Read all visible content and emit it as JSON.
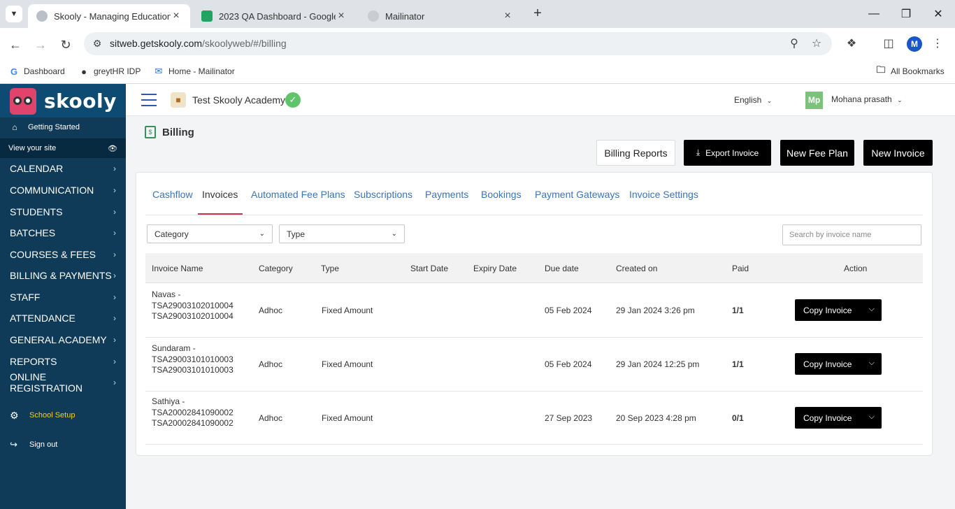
{
  "browser": {
    "tabs": [
      {
        "title": "Skooly - Managing Educational",
        "active": true
      },
      {
        "title": "2023 QA Dashboard - Google S",
        "active": false
      },
      {
        "title": "Mailinator",
        "active": false
      }
    ],
    "url_host": "sitweb.getskooly.com",
    "url_path": "/skoolyweb/#/billing",
    "profile_initial": "M",
    "bookmarks": [
      "Dashboard",
      "greytHR IDP",
      "Home - Mailinator"
    ],
    "all_bookmarks": "All Bookmarks"
  },
  "sidebar": {
    "brand": "skooly",
    "getting_started": "Getting Started",
    "view_site": "View your site",
    "menu": [
      "CALENDAR",
      "COMMUNICATION",
      "STUDENTS",
      "BATCHES",
      "COURSES & FEES",
      "BILLING & PAYMENTS",
      "STAFF",
      "ATTENDANCE",
      "GENERAL ACADEMY",
      "REPORTS",
      "ONLINE REGISTRATION"
    ],
    "school_setup": "School Setup",
    "sign_out": "Sign out"
  },
  "header": {
    "school_name": "Test Skooly Academy",
    "language": "English",
    "user_initials": "Mp",
    "user_name": "Mohana prasath"
  },
  "page": {
    "title": "Billing",
    "buttons": {
      "billing_reports": "Billing Reports",
      "export_invoice": "Export Invoice",
      "new_fee_plan": "New Fee Plan",
      "new_invoice": "New Invoice"
    },
    "tabs": [
      "Cashflow",
      "Invoices",
      "Automated Fee Plans",
      "Subscriptions",
      "Payments",
      "Bookings",
      "Payment Gateways",
      "Invoice Settings"
    ],
    "active_tab": "Invoices",
    "filters": {
      "category": "Category",
      "type": "Type",
      "search_placeholder": "Search by invoice name"
    },
    "table": {
      "columns": [
        "Invoice Name",
        "Category",
        "Type",
        "Start Date",
        "Expiry Date",
        "Due date",
        "Created on",
        "Paid",
        "Action"
      ],
      "rows": [
        {
          "name_line1": "Navas -",
          "name_line2": "TSA29003102010004",
          "name_line3": "TSA29003102010004",
          "category": "Adhoc",
          "type": "Fixed Amount",
          "start_date": "",
          "expiry_date": "",
          "due_date": "05 Feb 2024",
          "created_on": "29 Jan 2024 3:26 pm",
          "paid": "1/1",
          "action": "Copy Invoice"
        },
        {
          "name_line1": "Sundaram -",
          "name_line2": "TSA29003101010003",
          "name_line3": "TSA29003101010003",
          "category": "Adhoc",
          "type": "Fixed Amount",
          "start_date": "",
          "expiry_date": "",
          "due_date": "05 Feb 2024",
          "created_on": "29 Jan 2024 12:25 pm",
          "paid": "1/1",
          "action": "Copy Invoice"
        },
        {
          "name_line1": "Sathiya -",
          "name_line2": "TSA20002841090002",
          "name_line3": "TSA20002841090002",
          "category": "Adhoc",
          "type": "Fixed Amount",
          "start_date": "",
          "expiry_date": "",
          "due_date": "27 Sep 2023",
          "created_on": "20 Sep 2023 4:28 pm",
          "paid": "0/1",
          "action": "Copy Invoice"
        }
      ]
    }
  },
  "colors": {
    "sidebar_bg": "#0f3b58",
    "brand_bg": "#0e4b73",
    "accent_link": "#3b74b5",
    "active_underline": "#c8334f",
    "school_setup_text": "#f2cf2a",
    "verified_green": "#5ec46a"
  }
}
